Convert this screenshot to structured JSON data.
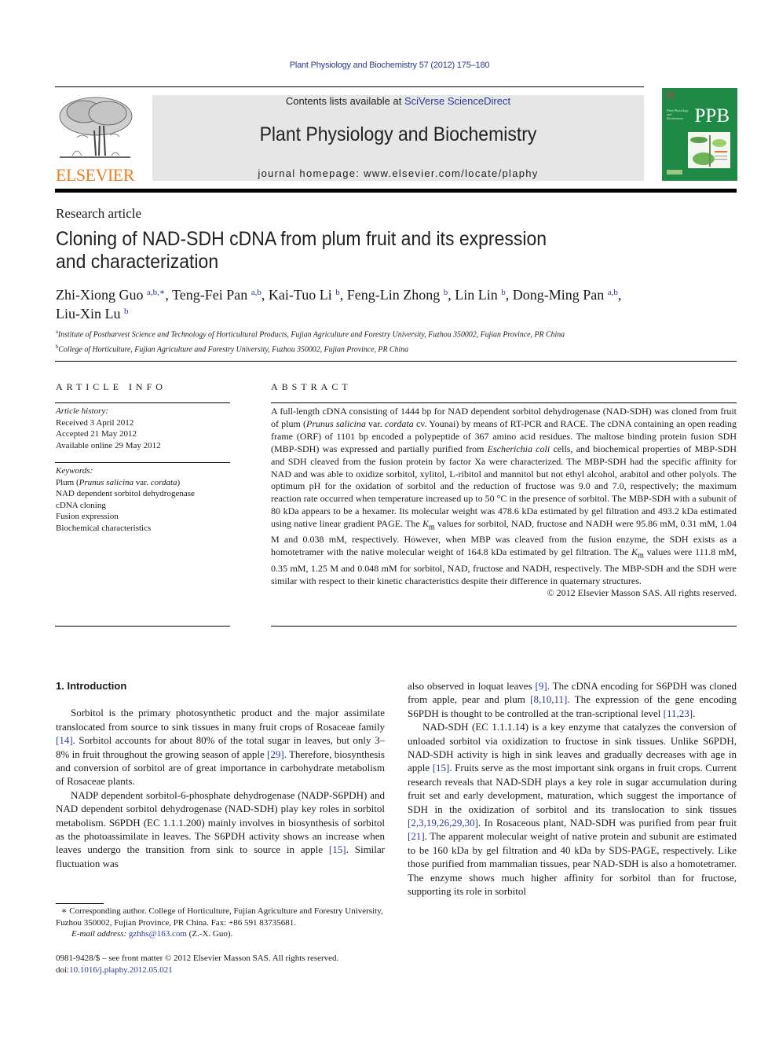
{
  "header": {
    "citation": "Plant Physiology and Biochemistry 57 (2012) 175–180",
    "contents_prefix": "Contents lists available at ",
    "contents_link": "SciVerse ScienceDirect",
    "journal_title": "Plant Physiology and Biochemistry",
    "homepage_prefix": "journal homepage: ",
    "homepage_url": "www.elsevier.com/locate/plaphy",
    "publisher_logo": "ELSEVIER",
    "cover_abbrev": "PPB",
    "cover_small_title": "Plant Physiology and Biochemistry"
  },
  "article": {
    "type": "Research article",
    "title": "Cloning of NAD-SDH cDNA from plum fruit and its expression and characterization",
    "title_line1": "Cloning of NAD-SDH cDNA from plum fruit and its expression",
    "title_line2": "and characterization",
    "authors": [
      {
        "name": "Zhi-Xiong Guo",
        "sup": "a,b,∗",
        "sep": ", "
      },
      {
        "name": "Teng-Fei Pan",
        "sup": "a,b",
        "sep": ", "
      },
      {
        "name": "Kai-Tuo Li",
        "sup": "b",
        "sep": ", "
      },
      {
        "name": "Feng-Lin Zhong",
        "sup": "b",
        "sep": ", "
      },
      {
        "name": "Lin Lin",
        "sup": "b",
        "sep": ", "
      },
      {
        "name": "Dong-Ming Pan",
        "sup": "a,b",
        "sep": ","
      },
      {
        "name": "Liu-Xin Lu",
        "sup": "b",
        "sep": ""
      }
    ],
    "affiliations": [
      {
        "mark": "a",
        "text": "Institute of Postharvest Science and Technology of Horticultural Products, Fujian Agriculture and Forestry University, Fuzhou 350002, Fujian Province, PR China"
      },
      {
        "mark": "b",
        "text": "College of Horticulture, Fujian Agriculture and Forestry University, Fuzhou 350002, Fujian Province, PR China"
      }
    ]
  },
  "article_info": {
    "heading": "ARTICLE INFO",
    "history_label": "Article history:",
    "received": "Received 3 April 2012",
    "accepted": "Accepted 21 May 2012",
    "online": "Available online 29 May 2012",
    "keywords_label": "Keywords:",
    "keyword1_prefix": "Plum (",
    "keyword1_italic1": "Prunus salicina",
    "keyword1_mid": " var. ",
    "keyword1_italic2": "cordata",
    "keyword1_suffix": ")",
    "keywords": [
      "NAD dependent sorbitol dehydrogenase",
      "cDNA cloning",
      "Fusion expression",
      "Biochemical characteristics"
    ]
  },
  "abstract": {
    "heading": "ABSTRACT",
    "s1": "A full-length cDNA consisting of 1444 bp for NAD dependent sorbitol dehydrogenase (NAD-SDH) was cloned from fruit of plum (",
    "s1_i1": "Prunus salicina",
    "s1_mid": " var. ",
    "s1_i2": "cordata",
    "s1_end": " cv. Younai) by means of RT-PCR and RACE. The cDNA containing an open reading frame (ORF) of 1101 bp encoded a polypeptide of 367 amino acid residues. The maltose binding protein fusion SDH (MBP-SDH) was expressed and partially purified from ",
    "s2_i": "Escherichia coli",
    "s2": " cells, and biochemical properties of MBP-SDH and SDH cleaved from the fusion protein by factor Xa were characterized. The MBP-SDH had the specific affinity for NAD and was able to oxidize sorbitol, xylitol, L-ribitol and mannitol but not ethyl alcohol, arabitol and other polyols. The optimum pH for the oxidation of sorbitol and the reduction of fructose was 9.0 and 7.0, respectively; the maximum reaction rate occurred when temperature increased up to 50 °C in the presence of sorbitol. The MBP-SDH with a subunit of 80 kDa appears to be a hexamer. Its molecular weight was 478.6 kDa estimated by gel filtration and 493.2 kDa estimated using native linear gradient PAGE. The ",
    "km": "K",
    "km_sub": "m",
    "s3": " values for sorbitol, NAD, fructose and NADH were 95.86 mM, 0.31 mM, 1.04 M and 0.038 mM, respectively. However, when MBP was cleaved from the fusion enzyme, the SDH exists as a homotetramer with the native molecular weight of 164.8 kDa estimated by gel filtration. The ",
    "s4": " values were 111.8 mM, 0.35 mM, 1.25 M and 0.048 mM for sorbitol, NAD, fructose and NADH, respectively. The MBP-SDH and the SDH were similar with respect to their kinetic characteristics despite their difference in quaternary structures.",
    "copyright": "© 2012 Elsevier Masson SAS. All rights reserved."
  },
  "body": {
    "intro_heading": "1.  Introduction",
    "p1_a": "Sorbitol is the primary photosynthetic product and the major assimilate translocated from source to sink tissues in many fruit crops of Rosaceae family ",
    "p1_r1": "[14]",
    "p1_b": ". Sorbitol accounts for about 80% of the total sugar in leaves, but only 3–8% in fruit throughout the growing season of apple ",
    "p1_r2": "[29]",
    "p1_c": ". Therefore, biosynthesis and conversion of sorbitol are of great importance in carbohydrate metabolism of Rosaceae plants.",
    "p2_a": "NADP dependent sorbitol-6-phosphate dehydrogenase (NADP-S6PDH) and NAD dependent sorbitol dehydrogenase (NAD-SDH) play key roles in sorbitol metabolism. S6PDH (EC 1.1.1.200) mainly involves in biosynthesis of sorbitol as the photoassimilate in leaves. The S6PDH activity shows an increase when leaves undergo the transition from sink to source in apple ",
    "p2_r1": "[15]",
    "p2_b": ". Similar fluctuation was",
    "r1_a": "also observed in loquat leaves ",
    "r1_r1": "[9]",
    "r1_b": ". The cDNA encoding for S6PDH was cloned from apple, pear and plum ",
    "r1_r2": "[8,10,11]",
    "r1_c": ". The expression of the gene encoding S6PDH is thought to be controlled at the tran-scriptional level ",
    "r1_r3": "[11,23]",
    "r1_d": ".",
    "r2_a": "NAD-SDH (EC 1.1.1.14) is a key enzyme that catalyzes the conversion of unloaded sorbitol via oxidization to fructose in sink tissues. Unlike S6PDH, NAD-SDH activity is high in sink leaves and gradually decreases with age in apple ",
    "r2_r1": "[15]",
    "r2_b": ". Fruits serve as the most important sink organs in fruit crops. Current research reveals that NAD-SDH plays a key role in sugar accumulation during fruit set and early development, maturation, which suggest the importance of SDH in the oxidization of sorbitol and its translocation to sink tissues ",
    "r2_r2": "[2,3,19,26,29,30]",
    "r2_c": ". In Rosaceous plant, NAD-SDH was purified from pear fruit ",
    "r2_r3": "[21]",
    "r2_d": ". The apparent molecular weight of native protein and subunit are estimated to be 160 kDa by gel filtration and 40 kDa by SDS-PAGE, respectively. Like those purified from mammalian tissues, pear NAD-SDH is also a homotetramer. The enzyme shows much higher affinity for sorbitol than for fructose, supporting its role in sorbitol"
  },
  "footnotes": {
    "star": "∗",
    "corresponding": " Corresponding author. College of Horticulture, Fujian Agriculture and Forestry University, Fuzhou 350002, Fujian Province, PR China. Fax: +86 591 83735681.",
    "email_label": "E-mail address:",
    "email": "gzhhs@163.com",
    "email_owner": " (Z.-X. Guo).",
    "front_matter": "0981-9428/$ – see front matter © 2012 Elsevier Masson SAS. All rights reserved.",
    "doi_label": "doi:",
    "doi": "10.1016/j.plaphy.2012.05.021"
  }
}
